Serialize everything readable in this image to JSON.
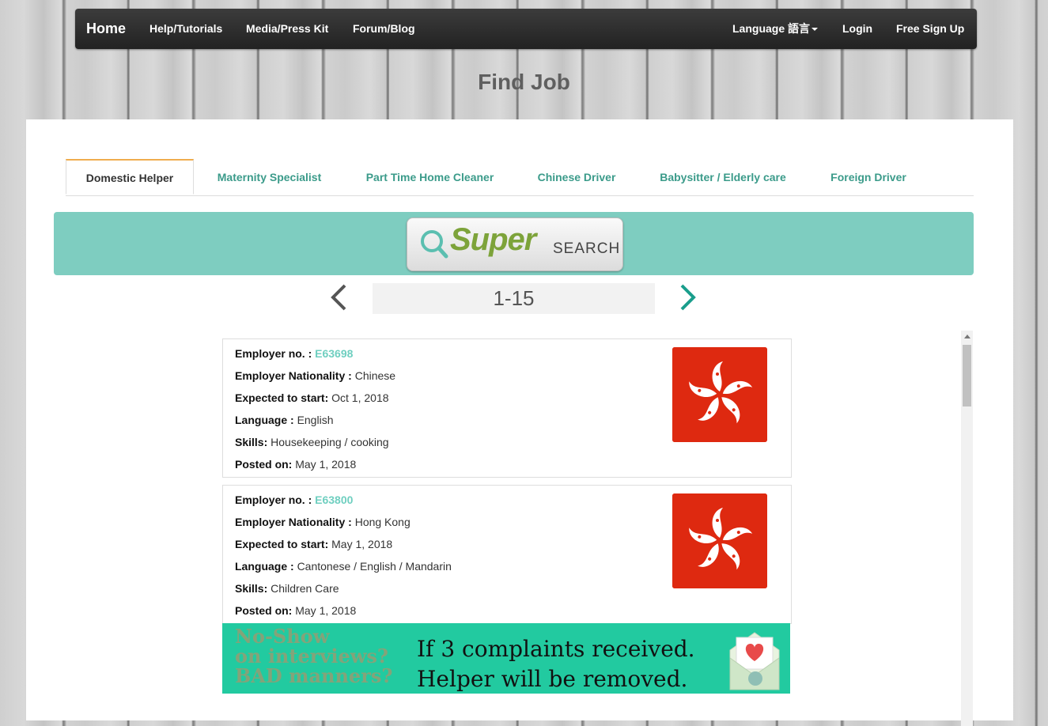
{
  "nav": {
    "brand": "Home",
    "left_links": [
      "Help/Tutorials",
      "Media/Press Kit",
      "Forum/Blog"
    ],
    "language": "Language 語言",
    "login": "Login",
    "signup": "Free Sign Up"
  },
  "page_title": "Find Job",
  "tabs": [
    "Domestic Helper",
    "Maternity Specialist",
    "Part Time Home Cleaner",
    "Chinese Driver",
    "Babysitter / Elderly care",
    "Foreign Driver"
  ],
  "active_tab": "Domestic Helper",
  "super_search": {
    "super": "Super",
    "search": "SEARCH"
  },
  "pager": {
    "range": "1-15"
  },
  "listings": [
    {
      "employer_no_label": "Employer no. :",
      "employer_no": "E63698",
      "nationality_label": "Employer Nationality :",
      "nationality": "Chinese",
      "start_label": "Expected to start:",
      "start": "Oct 1, 2018",
      "language_label": "Language :",
      "language": "English",
      "skills_label": "Skills:",
      "skills": "Housekeeping / cooking",
      "posted_label": "Posted on:",
      "posted": "May 1, 2018",
      "flag": "hong-kong-flag-icon"
    },
    {
      "employer_no_label": "Employer no. :",
      "employer_no": "E63800",
      "nationality_label": "Employer Nationality :",
      "nationality": "Hong Kong",
      "start_label": "Expected to start:",
      "start": "May 1, 2018",
      "language_label": "Language :",
      "language": "Cantonese / English / Mandarin",
      "skills_label": "Skills:",
      "skills": "Children Care",
      "posted_label": "Posted on:",
      "posted": "May 1, 2018",
      "flag": "hong-kong-flag-icon"
    }
  ],
  "notice": {
    "left_lines": [
      "No-Show",
      "on interviews?",
      "BAD manners?"
    ],
    "right_lines": [
      "If 3 complaints received.",
      "Helper will be removed."
    ]
  },
  "colors": {
    "accent": "#3b9b8a",
    "banner": "#7ecdc0",
    "link": "#6fcfc0",
    "flag_red": "#de2910",
    "tab_active_top": "#f0ad4e"
  }
}
